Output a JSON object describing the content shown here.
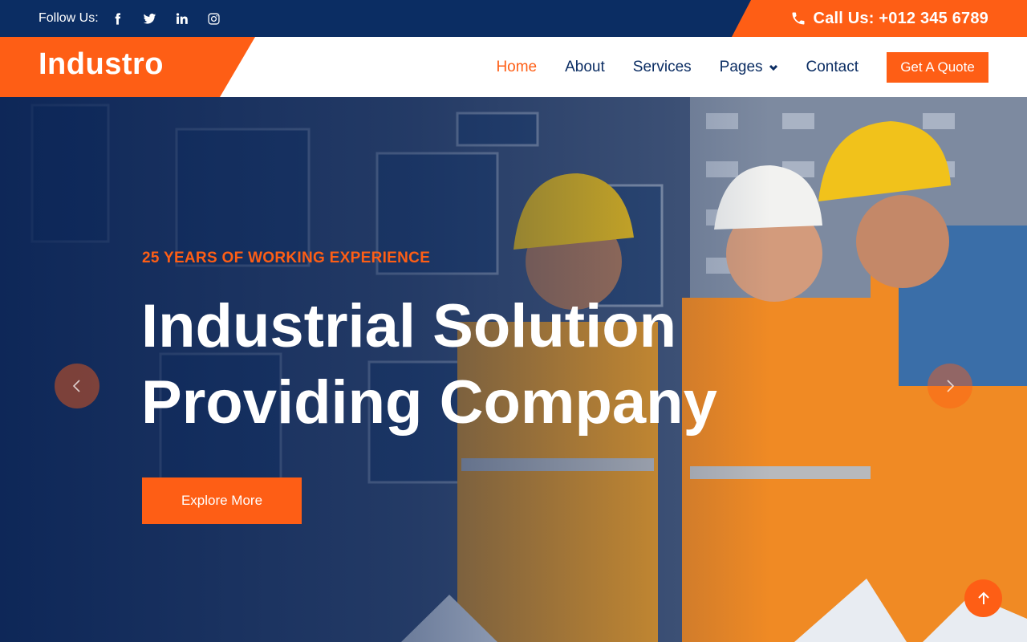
{
  "topbar": {
    "follow_label": "Follow Us:",
    "socials": [
      "facebook-icon",
      "twitter-icon",
      "linkedin-icon",
      "instagram-icon"
    ],
    "call_text": "Call Us: +012 345 6789"
  },
  "nav": {
    "brand": "Industro",
    "items": [
      {
        "label": "Home",
        "active": true
      },
      {
        "label": "About"
      },
      {
        "label": "Services"
      },
      {
        "label": "Pages",
        "dropdown": true
      },
      {
        "label": "Contact"
      }
    ],
    "cta": "Get A Quote"
  },
  "hero": {
    "subtitle": "25 YEARS OF WORKING EXPERIENCE",
    "title_line1": "Industrial Solution",
    "title_line2": "Providing Company",
    "button": "Explore More"
  },
  "colors": {
    "accent": "#fe5e15",
    "navy": "#0b2d63"
  }
}
